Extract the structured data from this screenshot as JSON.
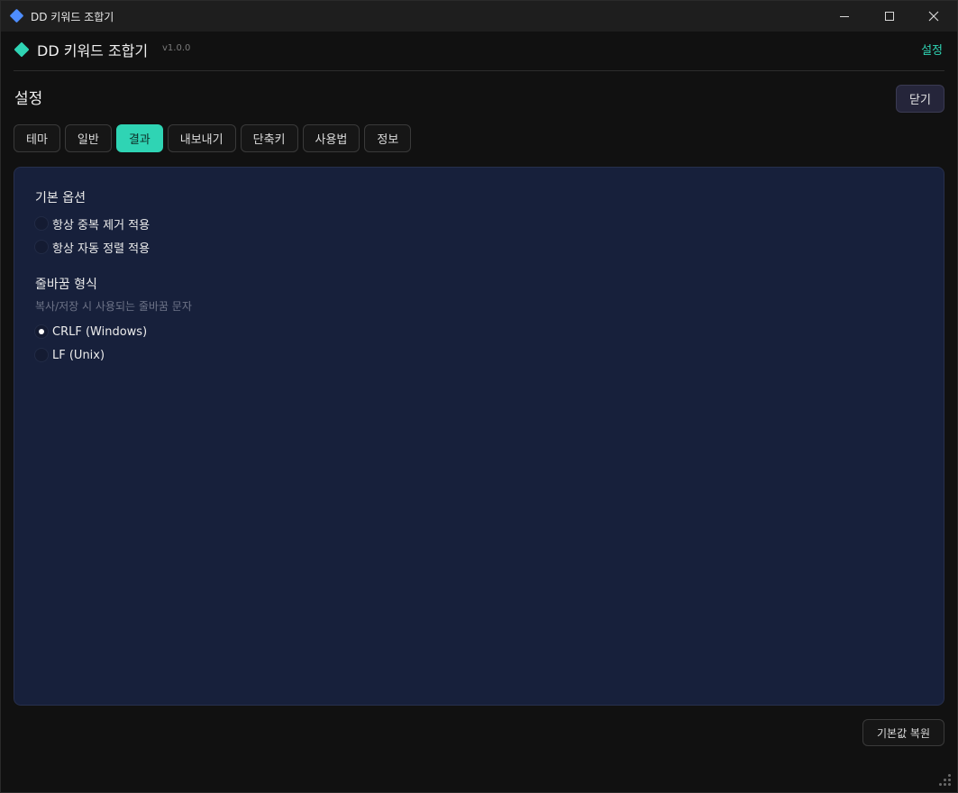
{
  "window": {
    "title": "DD 키워드 조합기"
  },
  "header": {
    "app_name": "DD 키워드 조합기",
    "version": "v1.0.0",
    "settings_link": "설정",
    "accent_color": "#2fd4b4"
  },
  "settings": {
    "title": "설정",
    "close_label": "닫기",
    "tabs": [
      {
        "label": "테마",
        "active": false
      },
      {
        "label": "일반",
        "active": false
      },
      {
        "label": "결과",
        "active": true
      },
      {
        "label": "내보내기",
        "active": false
      },
      {
        "label": "단축키",
        "active": false
      },
      {
        "label": "사용법",
        "active": false
      },
      {
        "label": "정보",
        "active": false
      }
    ],
    "basic_options": {
      "title": "기본 옵션",
      "items": [
        {
          "label": "항상 중복 제거 적용",
          "checked": false
        },
        {
          "label": "항상 자동 정렬 적용",
          "checked": false
        }
      ]
    },
    "line_ending": {
      "title": "줄바꿈 형식",
      "description": "복사/저장 시 사용되는 줄바꿈 문자",
      "options": [
        {
          "label": "CRLF (Windows)",
          "selected": true
        },
        {
          "label": "LF (Unix)",
          "selected": false
        }
      ]
    },
    "reset_label": "기본값 복원"
  }
}
